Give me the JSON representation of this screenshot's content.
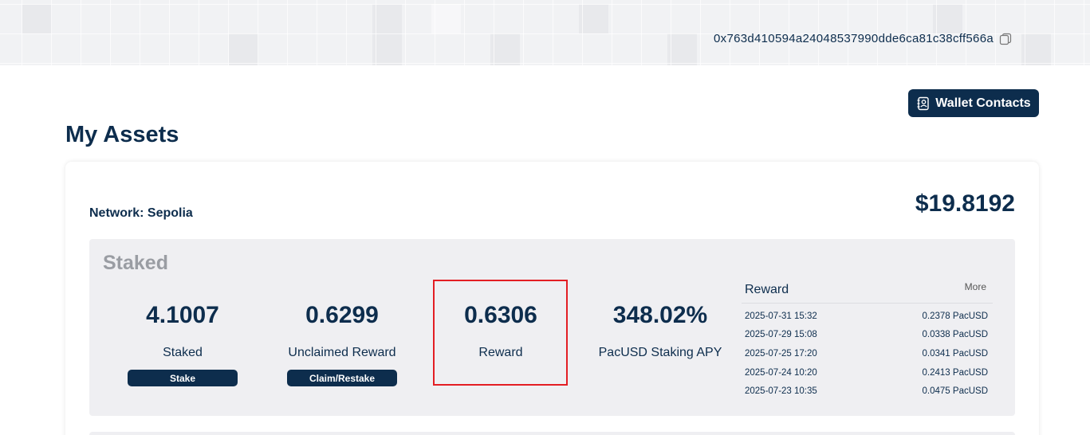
{
  "header": {
    "wallet_address": "0x763d410594a24048537990dde6ca81c38cff566a",
    "copy_icon": "copy-icon"
  },
  "wallet_contacts": {
    "label": "Wallet Contacts",
    "icon": "contacts-book-icon"
  },
  "page_title": "My Assets",
  "card": {
    "network_label": "Network: Sepolia",
    "total_value": "$19.8192",
    "staked_panel": {
      "title": "Staked",
      "stats": [
        {
          "value": "4.1007",
          "label": "Staked",
          "button": "Stake"
        },
        {
          "value": "0.6299",
          "label": "Unclaimed Reward",
          "button": "Claim/Restake"
        },
        {
          "value": "0.6306",
          "label": "Reward"
        },
        {
          "value": "348.02%",
          "label": "PacUSD Staking APY"
        }
      ],
      "reward_list": {
        "title": "Reward",
        "more_label": "More",
        "rows": [
          {
            "date": "2025-07-31 15:32",
            "amount": "0.2378 PacUSD"
          },
          {
            "date": "2025-07-29 15:08",
            "amount": "0.0338 PacUSD"
          },
          {
            "date": "2025-07-25 17:20",
            "amount": "0.0341 PacUSD"
          },
          {
            "date": "2025-07-24 10:20",
            "amount": "0.2413 PacUSD"
          },
          {
            "date": "2025-07-23 10:35",
            "amount": "0.0475 PacUSD"
          }
        ]
      }
    }
  },
  "colors": {
    "primary": "#0d2d4d",
    "panel_bg": "#efeff2",
    "header_bg": "#f1f2f4",
    "highlight": "#e31e24",
    "muted_title": "#9a9da3"
  }
}
